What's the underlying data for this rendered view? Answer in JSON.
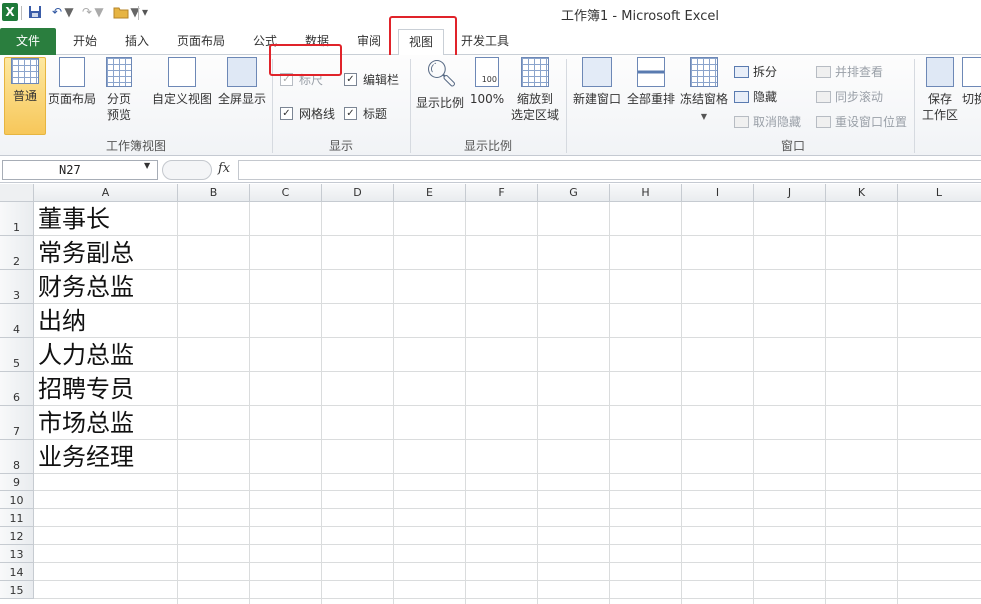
{
  "app": {
    "title": "工作簿1 - Microsoft Excel",
    "logo_icon": "excel-logo-icon"
  },
  "quick_access": {
    "save_icon": "save-icon",
    "undo_icon": "undo-icon",
    "redo_icon": "redo-icon",
    "open_icon": "open-folder-icon"
  },
  "tabs": [
    {
      "label": "文件"
    },
    {
      "label": "开始"
    },
    {
      "label": "插入"
    },
    {
      "label": "页面布局"
    },
    {
      "label": "公式"
    },
    {
      "label": "数据"
    },
    {
      "label": "审阅"
    },
    {
      "label": "视图",
      "active": true
    },
    {
      "label": "开发工具"
    }
  ],
  "ribbon": {
    "workbook_views": {
      "label": "工作簿视图",
      "normal": "普通",
      "page_layout": "页面布局",
      "page_break_line1": "分页",
      "page_break_line2": "预览",
      "custom_views": "自定义视图",
      "full_screen": "全屏显示"
    },
    "show": {
      "label": "显示",
      "ruler": {
        "label": "标尺",
        "checked": true,
        "enabled": false
      },
      "formula_bar": {
        "label": "编辑栏",
        "checked": true,
        "enabled": true
      },
      "gridlines": {
        "label": "网格线",
        "checked": true,
        "enabled": true
      },
      "headings": {
        "label": "标题",
        "checked": true,
        "enabled": true
      }
    },
    "zoom": {
      "label": "显示比例",
      "zoom": "显示比例",
      "hundred": "100%",
      "hundred_badge": "100",
      "zoom_selection_line1": "缩放到",
      "zoom_selection_line2": "选定区域"
    },
    "window": {
      "label": "窗口",
      "new_window": "新建窗口",
      "arrange_all": "全部重排",
      "freeze_panes": "冻结窗格",
      "split": "拆分",
      "hide": "隐藏",
      "unhide": "取消隐藏",
      "side_by_side": "并排查看",
      "sync_scroll": "同步滚动",
      "reset_position": "重设窗口位置",
      "save_workspace_line1": "保存",
      "save_workspace_line2": "工作区",
      "switch_windows": "切换"
    }
  },
  "formula_bar": {
    "name_box": "N27",
    "fx": "fx",
    "value": ""
  },
  "sheet": {
    "columns": [
      "A",
      "B",
      "C",
      "D",
      "E",
      "F",
      "G",
      "H",
      "I",
      "J",
      "K",
      "L"
    ],
    "rows": [
      "1",
      "2",
      "3",
      "4",
      "5",
      "6",
      "7",
      "8",
      "9",
      "10",
      "11",
      "12",
      "13",
      "14",
      "15"
    ],
    "cells_a": [
      "董事长",
      "常务副总",
      "财务总监",
      "出纳",
      "人力总监",
      "招聘专员",
      "市场总监",
      "业务经理"
    ]
  },
  "colors": {
    "file_tab": "#2a7e3e",
    "highlight_box": "#e0232a",
    "active_button": "#f7c75a"
  }
}
